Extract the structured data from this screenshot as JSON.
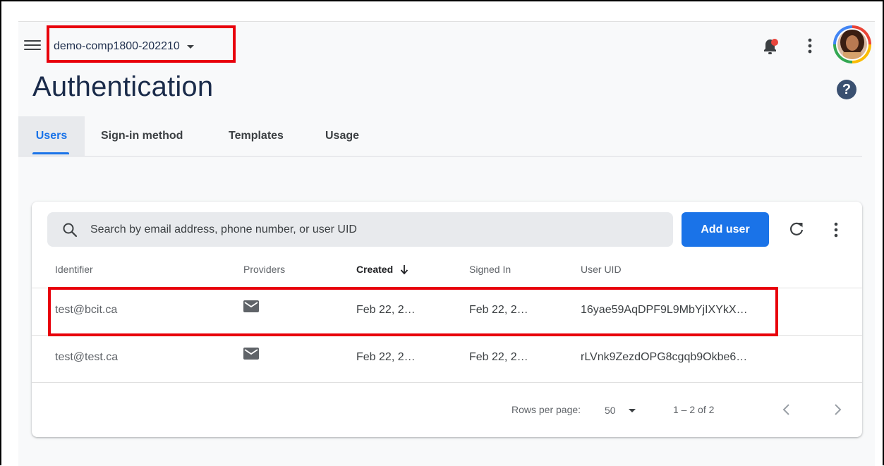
{
  "header": {
    "project_name": "demo-comp1800-202210",
    "page_title": "Authentication",
    "help_label": "?"
  },
  "tabs": [
    {
      "label": "Users",
      "active": true
    },
    {
      "label": "Sign-in method",
      "active": false
    },
    {
      "label": "Templates",
      "active": false
    },
    {
      "label": "Usage",
      "active": false
    }
  ],
  "search": {
    "placeholder": "Search by email address, phone number, or user UID"
  },
  "toolbar": {
    "add_user_label": "Add user"
  },
  "table": {
    "columns": [
      "Identifier",
      "Providers",
      "Created",
      "Signed In",
      "User UID"
    ],
    "sorted_column": "Created",
    "rows": [
      {
        "identifier": "test@bcit.ca",
        "provider": "mail-icon",
        "created": "Feb 22, 2…",
        "signed_in": "Feb 22, 2…",
        "uid": "16yae59AqDPF9L9MbYjIXYkX…",
        "highlighted": true
      },
      {
        "identifier": "test@test.ca",
        "provider": "mail-icon",
        "created": "Feb 22, 2…",
        "signed_in": "Feb 22, 2…",
        "uid": "rLVnk9ZezdOPG8cgqb9Okbe6…",
        "highlighted": false
      }
    ]
  },
  "pagination": {
    "rows_per_page_label": "Rows per page:",
    "rows_per_page_value": "50",
    "range_text": "1 – 2 of 2"
  },
  "colors": {
    "accent": "#1a73e8",
    "highlight_box": "#e8000b",
    "title": "#1a2b4a"
  }
}
